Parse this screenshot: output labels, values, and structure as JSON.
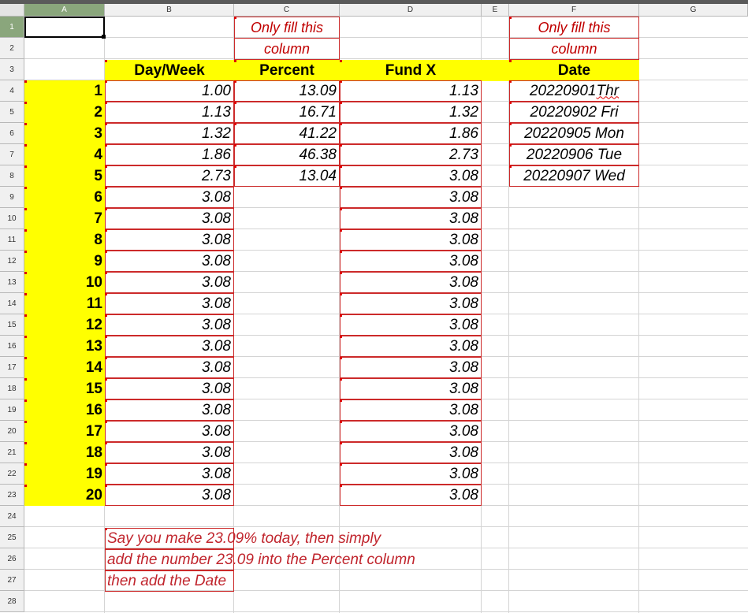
{
  "columns": [
    "A",
    "B",
    "C",
    "D",
    "E",
    "F",
    "G"
  ],
  "rows": [
    "1",
    "2",
    "3",
    "4",
    "5",
    "6",
    "7",
    "8",
    "9",
    "10",
    "11",
    "12",
    "13",
    "14",
    "15",
    "16",
    "17",
    "18",
    "19",
    "20",
    "21",
    "22",
    "23",
    "24",
    "25",
    "26",
    "27",
    "28"
  ],
  "instructions": {
    "c_line1": "Only fill this",
    "c_line2": "column",
    "f_line1": "Only fill this",
    "f_line2": "column"
  },
  "headers": {
    "day_week": "Day/Week",
    "percent": "Percent",
    "fund_x": "Fund X",
    "date": "Date"
  },
  "day_numbers": [
    "1",
    "2",
    "3",
    "4",
    "5",
    "6",
    "7",
    "8",
    "9",
    "10",
    "11",
    "12",
    "13",
    "14",
    "15",
    "16",
    "17",
    "18",
    "19",
    "20"
  ],
  "day_week_values": [
    "1.00",
    "1.13",
    "1.32",
    "1.86",
    "2.73",
    "3.08",
    "3.08",
    "3.08",
    "3.08",
    "3.08",
    "3.08",
    "3.08",
    "3.08",
    "3.08",
    "3.08",
    "3.08",
    "3.08",
    "3.08",
    "3.08",
    "3.08"
  ],
  "percent_values": [
    "13.09",
    "16.71",
    "41.22",
    "46.38",
    "13.04"
  ],
  "fund_x_values": [
    "1.13",
    "1.32",
    "1.86",
    "2.73",
    "3.08",
    "3.08",
    "3.08",
    "3.08",
    "3.08",
    "3.08",
    "3.08",
    "3.08",
    "3.08",
    "3.08",
    "3.08",
    "3.08",
    "3.08",
    "3.08",
    "3.08",
    "3.08"
  ],
  "dates": [
    "20220901 Thr",
    "20220902 Fri",
    "20220905 Mon",
    "20220906 Tue",
    "20220907 Wed"
  ],
  "note": {
    "line1": "Say you make 23.09% today, then simply",
    "line2": "add the number 23.09 into the Percent column",
    "line3": "then add the Date"
  },
  "colors": {
    "highlight": "#ffff00",
    "border_red": "#cc2a2a",
    "instruction_text": "#c0242c",
    "selected_header": "#8aa67c"
  }
}
